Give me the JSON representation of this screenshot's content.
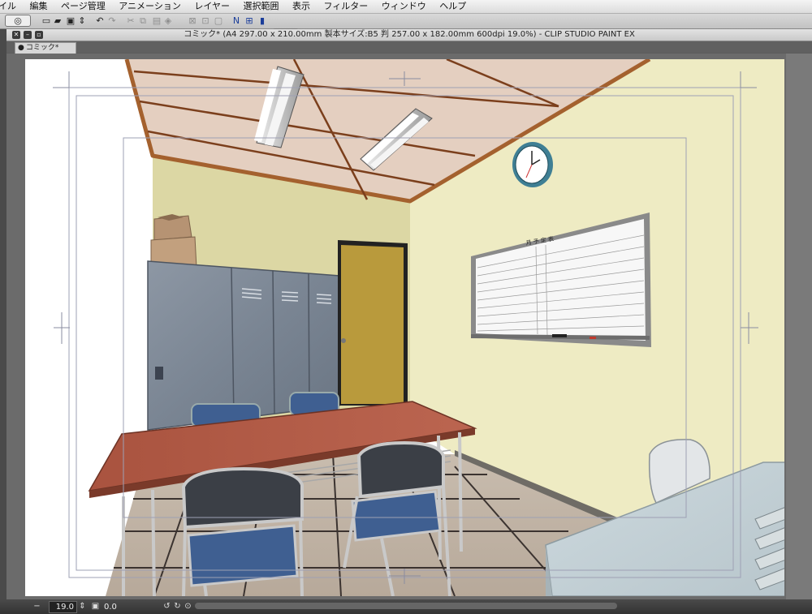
{
  "menu": {
    "items": [
      "イル",
      "編集",
      "ページ管理",
      "アニメーション",
      "レイヤー",
      "選択範囲",
      "表示",
      "フィルター",
      "ウィンドウ",
      "ヘルプ"
    ]
  },
  "toolbar": {
    "help_label": "?"
  },
  "document": {
    "title": "コミック* (A4 297.00 x 210.00mm 製本サイズ:B5 判 257.00 x 182.00mm 600dpi 19.0%) - CLIP STUDIO PAINT EX",
    "tab_label": "コミック*"
  },
  "whiteboard": {
    "heading": "月 予 定 表"
  },
  "status": {
    "zoom": "19.0",
    "rotation": "0.0"
  },
  "colors": {
    "ceiling": "#e4cfc0",
    "wall_back": "#dcd7a4",
    "wall_right": "#eeebc3",
    "door": "#b99a3c",
    "table": "#b05a44",
    "chair_seat": "#3f5f91"
  }
}
